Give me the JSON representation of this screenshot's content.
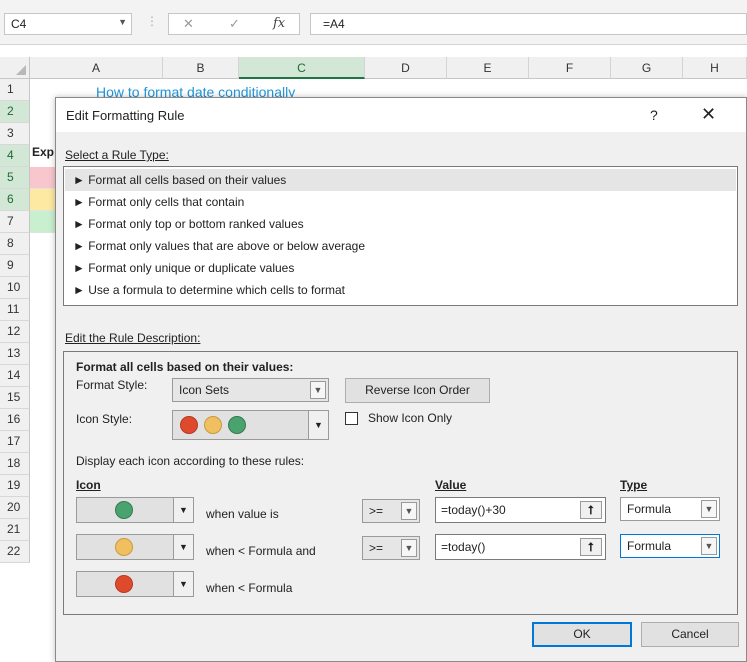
{
  "excel": {
    "name_box": "C4",
    "formula": "=A4",
    "fx_label": "fx",
    "columns": [
      "A",
      "B",
      "C",
      "D",
      "E",
      "F",
      "G",
      "H"
    ],
    "rows": [
      "1",
      "2",
      "3",
      "4",
      "5",
      "6",
      "7",
      "8",
      "9",
      "10",
      "11",
      "12",
      "13",
      "14",
      "15",
      "16",
      "17",
      "18",
      "19",
      "20",
      "21",
      "22"
    ],
    "sheet_title": "How to format date conditionally",
    "cell_a3": "Exp"
  },
  "dialog": {
    "title": "Edit Formatting Rule",
    "help": "?",
    "close": "✕",
    "select_rule_type_label": "Select a Rule Type:",
    "rule_types": [
      "► Format all cells based on their values",
      "► Format only cells that contain",
      "► Format only top or bottom ranked values",
      "► Format only values that are above or below average",
      "► Format only unique or duplicate values",
      "► Use a formula to determine which cells to format"
    ],
    "edit_description_label": "Edit the Rule Description:",
    "description_heading": "Format all cells based on their values:",
    "format_style_label": "Format Style:",
    "format_style_value": "Icon Sets",
    "reverse_icon_order": "Reverse Icon Order",
    "icon_style_label": "Icon Style:",
    "show_icon_only": "Show Icon Only",
    "display_rules_label": "Display each icon according to these rules:",
    "col_icon": "Icon",
    "col_value": "Value",
    "col_type": "Type",
    "rules": [
      {
        "condition": "when value is",
        "operator": ">=",
        "value": "=today()+30",
        "type": "Formula",
        "icon_color": "#4aa36f"
      },
      {
        "condition": "when < Formula and",
        "operator": ">=",
        "value": "=today()",
        "type": "Formula",
        "icon_color": "#f0c060"
      },
      {
        "condition": "when < Formula",
        "icon_color": "#e04a2c"
      }
    ],
    "ok": "OK",
    "cancel": "Cancel"
  },
  "colors": {
    "red": "#e04a2c",
    "yellow": "#f0c060",
    "green": "#4aa36f",
    "excel_green": "#217346"
  }
}
